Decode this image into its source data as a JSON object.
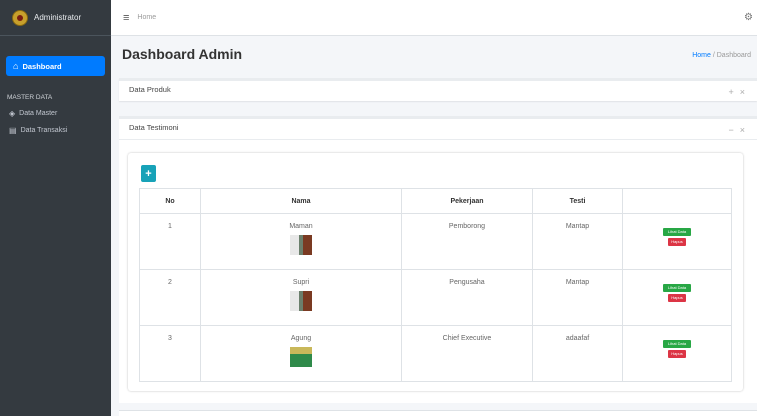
{
  "sidebar": {
    "brand": "Administrator",
    "dashboard_label": "Dashboard",
    "section_header": "MASTER DATA",
    "items": [
      {
        "label": "Data Master",
        "icon": "shield-icon"
      },
      {
        "label": "Data Transaksi",
        "icon": "database-icon"
      }
    ]
  },
  "topbar": {
    "home": "Home"
  },
  "page": {
    "title": "Dashboard Admin",
    "breadcrumb_home": "Home",
    "breadcrumb_sep": " / ",
    "breadcrumb_current": "Dashboard"
  },
  "cards": {
    "produk_title": "Data Produk",
    "testimoni_title": "Data Testimoni"
  },
  "table": {
    "headers": [
      "No",
      "Nama",
      "Pekerjaan",
      "Testi",
      ""
    ],
    "rows": [
      {
        "no": "1",
        "nama": "Maman",
        "pekerjaan": "Pemborong",
        "testi": "Mantap"
      },
      {
        "no": "2",
        "nama": "Supri",
        "pekerjaan": "Pengusaha",
        "testi": "Mantap"
      },
      {
        "no": "3",
        "nama": "Agung",
        "pekerjaan": "Chief Executive",
        "testi": "adaafaf"
      }
    ],
    "lihat_label": "Lihat Data",
    "hapus_label": "Hapus"
  },
  "colors": {
    "primary": "#007bff",
    "sidebar": "#343a40",
    "add": "#17a2b8",
    "success": "#28a745",
    "danger": "#dc3545"
  }
}
